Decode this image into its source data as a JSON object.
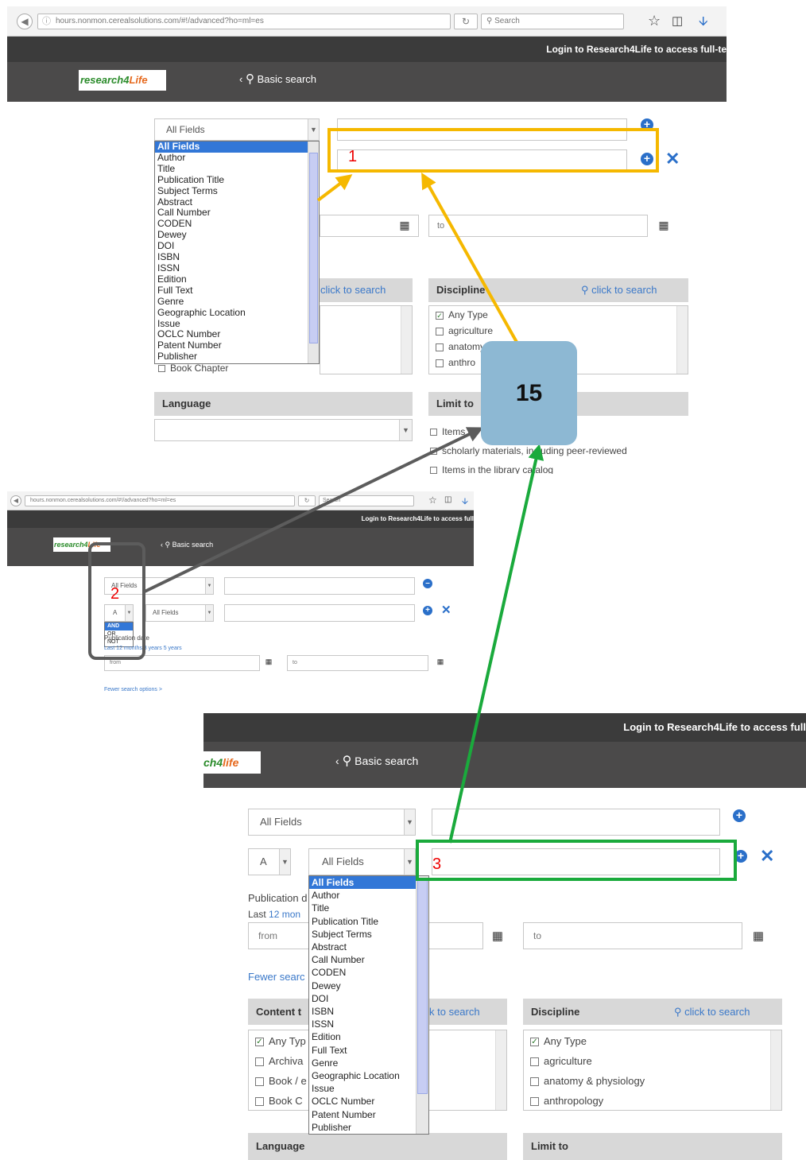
{
  "screen1": {
    "url": "hours.nonmon.cerealsolutions.com/#!/advanced?ho=ml=es",
    "search_placeholder": "Search",
    "login_text": "Login to Research4Life to access full-te",
    "logo_a": "research4",
    "logo_b": "Life",
    "basic_search": "Basic search",
    "field1_select": "All Fields",
    "field_options": [
      "All Fields",
      "Author",
      "Title",
      "Publication Title",
      "Subject Terms",
      "Abstract",
      "Call Number",
      "CODEN",
      "Dewey",
      "DOI",
      "ISBN",
      "ISSN",
      "Edition",
      "Full Text",
      "Genre",
      "Geographic Location",
      "Issue",
      "OCLC Number",
      "Patent Number",
      "Publisher"
    ],
    "to_placeholder": "to",
    "content_type_link": "click to search",
    "content_last_item": "Book Chapter",
    "discipline_title": "Discipline",
    "discipline_link": "click to search",
    "discipline_items": [
      "Any Type",
      "agriculture",
      "anatomy",
      "anthro"
    ],
    "language_title": "Language",
    "limit_title": "Limit to",
    "limit_items": [
      "Items w",
      "scholarly materials, including peer-reviewed",
      "Items in the library catalog"
    ]
  },
  "screen2": {
    "url": "hours.nonmon.cerealsolutions.com/#!/advanced?ho=ml=es",
    "search_placeholder": "Search",
    "login_text": "Login to Research4Life to access full",
    "logo_a": "research4",
    "logo_b": "Life",
    "basic_search": "Basic search",
    "row1_select": "All Fields",
    "bool_select": "A",
    "row2_select": "All Fields",
    "bool_options": [
      "AND",
      "OR",
      "NOT"
    ],
    "pub_date_label": "Publication date",
    "last_years": "Last 12 months 3 years 5 years",
    "from_placeholder": "from",
    "to_placeholder": "to",
    "fewer_options": "Fewer search options >"
  },
  "screen3": {
    "login_text": "Login to Research4Life to access full",
    "logo_a": "ch4",
    "logo_b": "life",
    "basic_search": "Basic search",
    "row1_select": "All Fields",
    "bool_select": "A",
    "row2_select": "All Fields",
    "field_options": [
      "All Fields",
      "Author",
      "Title",
      "Publication Title",
      "Subject Terms",
      "Abstract",
      "Call Number",
      "CODEN",
      "Dewey",
      "DOI",
      "ISBN",
      "ISSN",
      "Edition",
      "Full Text",
      "Genre",
      "Geographic Location",
      "Issue",
      "OCLC Number",
      "Patent Number",
      "Publisher"
    ],
    "pub_label": "Publication d",
    "last_prefix": "Last ",
    "last_link": "12 mon",
    "from_placeholder": "from",
    "to_placeholder": "to",
    "fewer": "Fewer searc",
    "content_title": "Content t",
    "content_link": "k to search",
    "content_items": [
      "Any Typ",
      "Archiva",
      "Book / e",
      "Book C"
    ],
    "discipline_title": "Discipline",
    "discipline_link": "click to search",
    "discipline_items": [
      "Any Type",
      "agriculture",
      "anatomy & physiology",
      "anthropology"
    ],
    "language_title": "Language",
    "limit_title": "Limit to"
  },
  "annotations": {
    "label1": "1",
    "label2": "2",
    "label3": "3",
    "badge": "15",
    "colors": {
      "yellow": "#f5b800",
      "gray": "#5c5c5c",
      "green": "#1aaa3c",
      "badge": "#8db8d3",
      "red_label": "#e00000"
    }
  },
  "icons": [
    "back-icon",
    "info-icon",
    "reload-icon",
    "search-icon",
    "star-icon",
    "clipboard-icon",
    "download-icon",
    "chevron-left-icon",
    "plus-circle-icon",
    "close-icon",
    "calendar-icon",
    "checkbox-icon"
  ]
}
